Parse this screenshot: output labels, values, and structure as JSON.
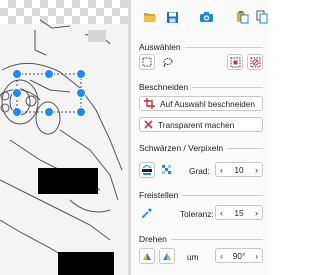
{
  "toolbar": {
    "icons": [
      "folder-open-icon",
      "save-icon",
      "camera-icon",
      "paste-icon",
      "copy-icon"
    ]
  },
  "auswaehlen": {
    "title": "Auswählen"
  },
  "beschneiden": {
    "title": "Beschneiden",
    "crop_label": "Auf Auswahl beschneiden",
    "transparent_label": "Transparent machen"
  },
  "schwaerzen": {
    "title": "Schwärzen / Verpixeln",
    "grad_label": "Grad:",
    "grad_value": "10"
  },
  "freistellen": {
    "title": "Freistellen",
    "toleranz_label": "Toleranz:",
    "toleranz_value": "15"
  },
  "drehen": {
    "title": "Drehen",
    "um_label": "um",
    "angle_value": "90°"
  },
  "colors": {
    "accent": "#1e88e5",
    "crop_red": "#d32f2f",
    "handle_blue": "#1e88ff"
  }
}
